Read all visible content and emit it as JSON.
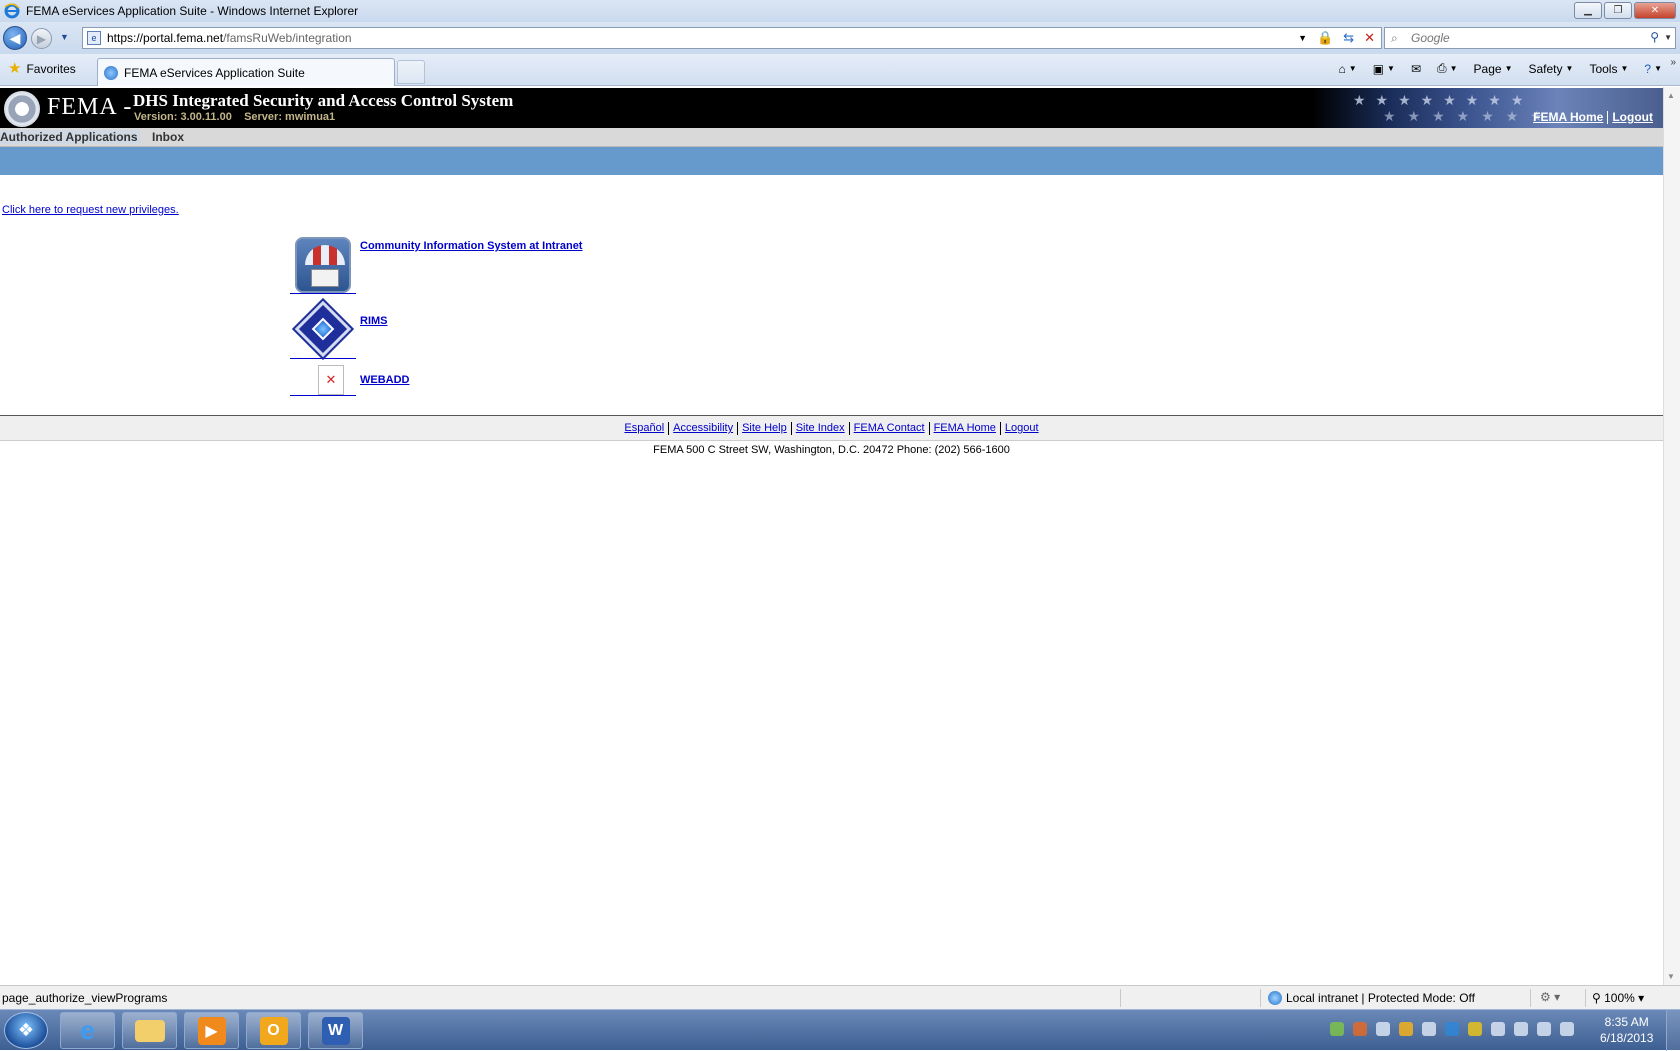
{
  "window": {
    "title": "FEMA eServices Application Suite - Windows Internet Explorer"
  },
  "browser": {
    "url_host": "https://portal.fema.net",
    "url_path": "/famsRuWeb/integration",
    "search_placeholder": "Google",
    "favorites_label": "Favorites",
    "tab_title": "FEMA eServices Application Suite",
    "commands": [
      "Page",
      "Safety",
      "Tools"
    ]
  },
  "header": {
    "agency": "FEMA -",
    "system_title": "DHS Integrated Security and Access Control System",
    "version": "Version: 3.00.11.00    Server: mwimua1",
    "fema_home": "FEMA Home",
    "logout": "Logout"
  },
  "nav": {
    "tabs": [
      {
        "label": "Authorized Applications",
        "active": true
      },
      {
        "label": "Inbox",
        "active": false
      }
    ]
  },
  "main": {
    "request_link": "Click here to request new privileges.",
    "apps": [
      {
        "label": "Community Information System at Intranet ",
        "icon": "cis-umbrella-house-icon"
      },
      {
        "label": "RIMS ",
        "icon": "rims-diamond-icon"
      },
      {
        "label": "WEBADD ",
        "icon": "broken-image-icon"
      }
    ]
  },
  "footer": {
    "links": [
      "Español",
      "Accessibility ",
      "Site Help ",
      "Site Index ",
      "FEMA Contact ",
      "FEMA Home ",
      "Logout"
    ],
    "address": "FEMA 500 C Street SW, Washington, D.C. 20472 Phone: (202) 566-1600"
  },
  "status": {
    "text": "page_authorize_viewPrograms",
    "zone": "Local intranet | Protected Mode: Off",
    "zoom": "100%"
  },
  "taskbar": {
    "time": "8:35 AM",
    "date": "6/18/2013"
  },
  "colors": {
    "header_bg": "#000000",
    "blue_bar": "#6699cc",
    "link": "#0000cc"
  }
}
